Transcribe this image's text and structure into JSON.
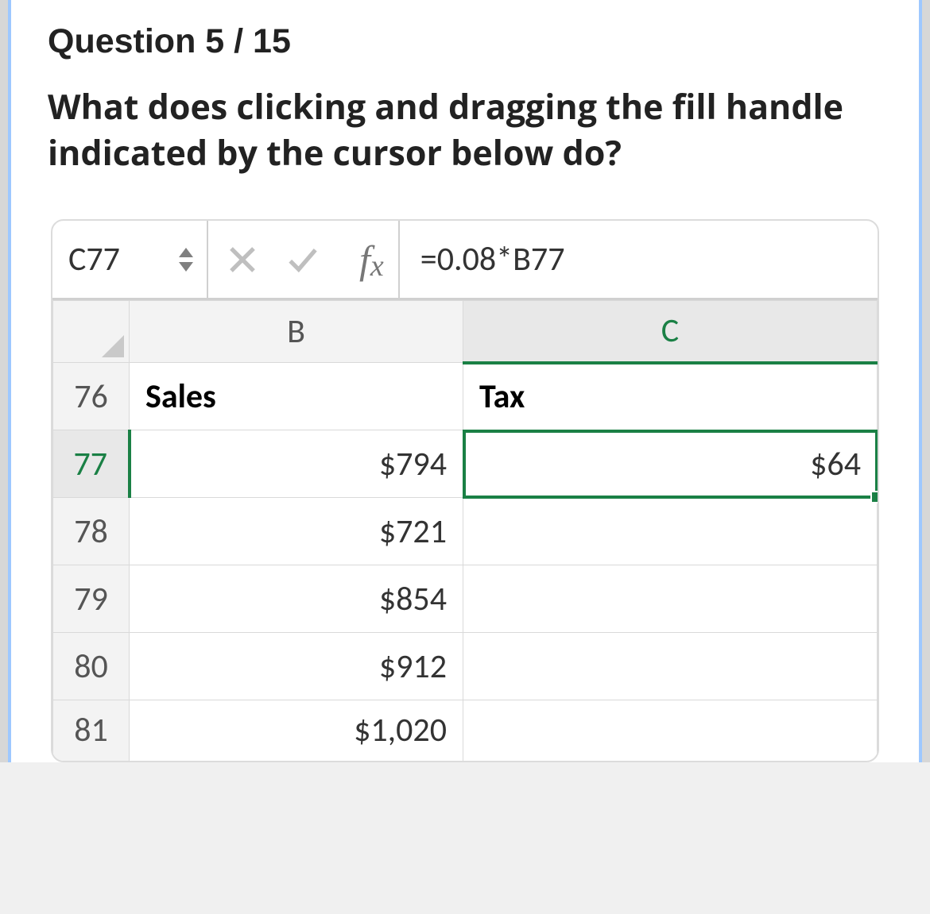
{
  "question": {
    "header": "Question 5 / 15",
    "text": "What does clicking and dragging the fill handle indicated by the cursor below do?"
  },
  "excel": {
    "namebox": "C77",
    "formula": "=0.08*B77",
    "columns": {
      "b": "B",
      "c": "C"
    },
    "selected_column": "C",
    "selected_row": "77",
    "rows": [
      {
        "num": "76",
        "b": "Sales",
        "c": "Tax",
        "header": true
      },
      {
        "num": "77",
        "b": "$794",
        "c": "$64",
        "selected": true
      },
      {
        "num": "78",
        "b": "$721",
        "c": ""
      },
      {
        "num": "79",
        "b": "$854",
        "c": ""
      },
      {
        "num": "80",
        "b": "$912",
        "c": ""
      },
      {
        "num": "81",
        "b": "$1,020",
        "c": ""
      }
    ]
  }
}
